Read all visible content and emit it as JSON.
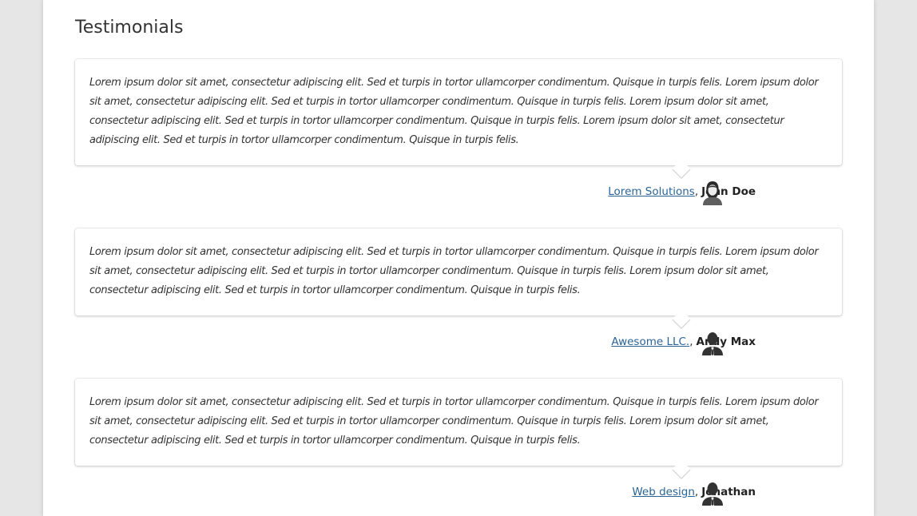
{
  "section": {
    "title": "Testimonials"
  },
  "testimonials": [
    {
      "quote": "Lorem ipsum dolor sit amet, consectetur adipiscing elit. Sed et turpis in tortor ullamcorper condimentum. Quisque in turpis felis. Lorem ipsum dolor sit amet, consectetur adipiscing elit. Sed et turpis in tortor ullamcorper condimentum. Quisque in turpis felis. Lorem ipsum dolor sit amet, consectetur adipiscing elit. Sed et turpis in tortor ullamcorper condimentum. Quisque in turpis felis. Lorem ipsum dolor sit amet, consectetur adipiscing elit. Sed et turpis in tortor ullamcorper condimentum. Quisque in turpis felis.",
      "company": "Lorem Solutions",
      "separator": ",",
      "author": "John Doe",
      "avatar_icon": "female-user-icon"
    },
    {
      "quote": "Lorem ipsum dolor sit amet, consectetur adipiscing elit. Sed et turpis in tortor ullamcorper condimentum. Quisque in turpis felis. Lorem ipsum dolor sit amet, consectetur adipiscing elit. Sed et turpis in tortor ullamcorper condimentum. Quisque in turpis felis. Lorem ipsum dolor sit amet, consectetur adipiscing elit. Sed et turpis in tortor ullamcorper condimentum. Quisque in turpis felis.",
      "company": "Awesome LLC.",
      "separator": ",",
      "author": "Andy Max",
      "avatar_icon": "male-user-icon"
    },
    {
      "quote": "Lorem ipsum dolor sit amet, consectetur adipiscing elit. Sed et turpis in tortor ullamcorper condimentum. Quisque in turpis felis. Lorem ipsum dolor sit amet, consectetur adipiscing elit. Sed et turpis in tortor ullamcorper condimentum. Quisque in turpis felis. Lorem ipsum dolor sit amet, consectetur adipiscing elit. Sed et turpis in tortor ullamcorper condimentum. Quisque in turpis felis.",
      "company": "Web design",
      "separator": ",",
      "author": "Jonathan",
      "avatar_icon": "male-user-icon"
    }
  ],
  "colors": {
    "background": "#e6e6e6",
    "page": "#ffffff",
    "link": "#2a6496",
    "text": "#333333"
  }
}
